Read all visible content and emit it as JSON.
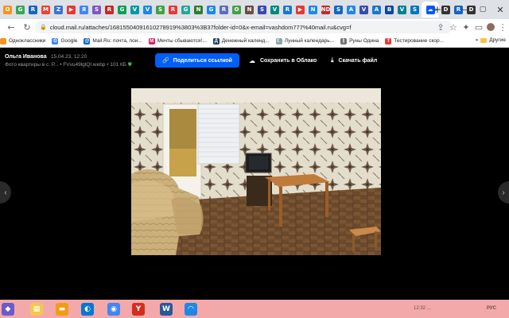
{
  "browser": {
    "tabs": [
      {
        "fav": "O",
        "color": "#f7931e"
      },
      {
        "fav": "G",
        "color": "#34a853"
      },
      {
        "fav": "R",
        "color": "#1565c0"
      },
      {
        "fav": "M",
        "color": "#ea4335"
      },
      {
        "fav": "Z",
        "color": "#3a76d1"
      },
      {
        "fav": "▶",
        "color": "#e53935"
      },
      {
        "fav": "Я",
        "color": "#4285f4"
      },
      {
        "fav": "S",
        "color": "#7e57c2"
      },
      {
        "fav": "R",
        "color": "#c62828"
      },
      {
        "fav": "G",
        "color": "#0f9d58"
      },
      {
        "fav": "V",
        "color": "#0097a7"
      },
      {
        "fav": "V",
        "color": "#1e88e5"
      },
      {
        "fav": "S",
        "color": "#43a047"
      },
      {
        "fav": "R",
        "color": "#e53935"
      },
      {
        "fav": "G",
        "color": "#26a69a"
      },
      {
        "fav": "N",
        "color": "#2e7d32"
      },
      {
        "fav": "G",
        "color": "#1e88e5"
      },
      {
        "fav": "R",
        "color": "#5c6bc0"
      },
      {
        "fav": "O",
        "color": "#43a047"
      },
      {
        "fav": "N",
        "color": "#6d4c41"
      },
      {
        "fav": "S",
        "color": "#3949ab"
      },
      {
        "fav": "V",
        "color": "#00897b"
      },
      {
        "fav": "R",
        "color": "#1976d2"
      },
      {
        "fav": "▶",
        "color": "#e53935"
      },
      {
        "fav": "N",
        "color": "#1e88e5"
      },
      {
        "fav": "ND",
        "color": "#c62828"
      },
      {
        "fav": "S",
        "color": "#1565c0"
      },
      {
        "fav": "A",
        "color": "#1e88e5"
      },
      {
        "fav": "V",
        "color": "#3949ab"
      },
      {
        "fav": "A",
        "color": "#1976d2"
      },
      {
        "fav": "B",
        "color": "#0d47a1"
      },
      {
        "fav": "V",
        "color": "#00838f"
      },
      {
        "fav": "S",
        "color": "#0277bd"
      }
    ],
    "active_tab": {
      "fav": "☁",
      "color": "#0058ff",
      "close": "×"
    },
    "after_tabs": [
      {
        "fav": "D",
        "color": "#333333"
      },
      {
        "fav": "R",
        "color": "#1565c0"
      },
      {
        "fav": "D",
        "color": "#333333"
      }
    ],
    "new_tab": "+",
    "url": "cloud.mail.ru/attaches/16815504091610278919%3803%3B37folder-id=0&x-email=vashdom777%40mail.ru&cvg=f",
    "bookmarks": [
      {
        "label": "Одноклассники",
        "color": "#f7931e",
        "glyph": ""
      },
      {
        "label": "Google",
        "color": "#4285f4",
        "glyph": "G"
      },
      {
        "label": "Mail.Ru: почта, пои...",
        "color": "#1565c0",
        "glyph": "@"
      },
      {
        "label": "Мечты сбываются!...",
        "color": "#e91e63",
        "glyph": "М"
      },
      {
        "label": "Денежный календ...",
        "color": "#1e3a5f",
        "glyph": "Д"
      },
      {
        "label": "Лунный календарь...",
        "color": "#90a4ae",
        "glyph": "☾"
      },
      {
        "label": "Руны Одина",
        "color": "#757575",
        "glyph": "ᚱ"
      },
      {
        "label": "Тестирование скор...",
        "color": "#e53935",
        "glyph": "T"
      }
    ],
    "bookmarks_overflow": "Другие"
  },
  "viewer": {
    "owner": "Ольга Иванова",
    "date": "15.04.23, 12:20",
    "file_title": "Фото квартиры в с. Р...",
    "file_name": "FVvu49lglQI.webp",
    "file_size": "101 КБ",
    "share_label": "Поделиться ссылкой",
    "save_label": "Сохранить в Облако",
    "download_label": "Скачать файл"
  },
  "taskbar": {
    "clock": "12:32 ...",
    "lang": "РУС",
    "app_colors": [
      "#6a5acd",
      "#f2c94c",
      "#f39c12",
      "#0078d4",
      "#4285f4",
      "#d62d20",
      "#2b579a",
      "#1e88e5"
    ]
  }
}
